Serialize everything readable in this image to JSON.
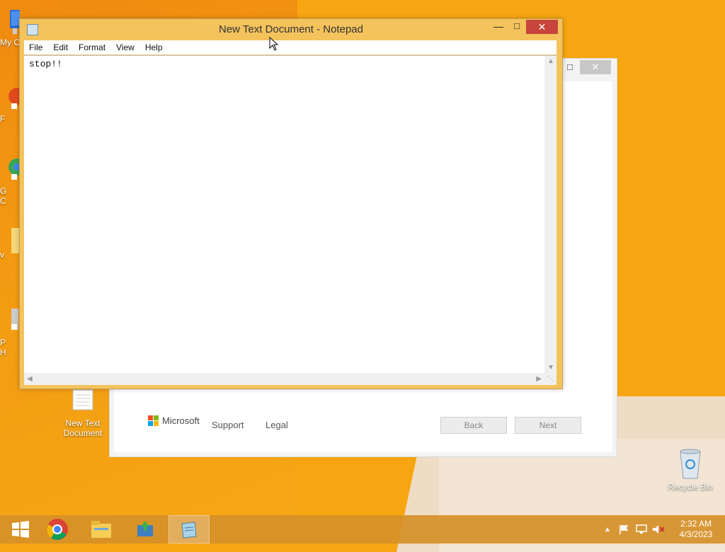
{
  "colors": {
    "desktop_bg": "#f7a611",
    "notepad_frame": "#f4c35c",
    "close_red": "#c7453a",
    "taskbar": "#d69028"
  },
  "desktop": {
    "partial_labels": [
      "My C",
      "F",
      "G",
      "C",
      "v",
      "P",
      "H"
    ],
    "icons": [
      {
        "label": "New Text Document",
        "icon": "text-file-icon"
      },
      {
        "label": "Recycle Bin",
        "icon": "recycle-bin-icon"
      }
    ]
  },
  "notepad": {
    "title": "New Text Document - Notepad",
    "menu": [
      "File",
      "Edit",
      "Format",
      "View",
      "Help"
    ],
    "content": "stop!!",
    "controls": {
      "minimize": "—",
      "maximize": "□",
      "close": "✕"
    }
  },
  "installer": {
    "brand": "Microsoft",
    "links": [
      "Support",
      "Legal"
    ],
    "buttons": {
      "back": "Back",
      "next": "Next"
    },
    "controls": {
      "maximize": "□",
      "close": "✕"
    }
  },
  "taskbar": {
    "items": [
      "start-button",
      "chrome-icon",
      "file-explorer-icon",
      "installer-app-icon",
      "notepad-app-icon"
    ],
    "active_item": "notepad-app-icon",
    "clock": {
      "time": "2:32 AM",
      "date": "4/3/2023"
    }
  }
}
